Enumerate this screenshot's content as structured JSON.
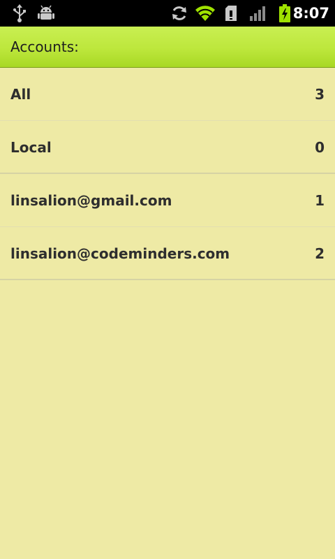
{
  "status_bar": {
    "time": "8:07",
    "icons": [
      "usb-icon",
      "android-debug-icon",
      "sync-icon",
      "wifi-icon",
      "sd-card-icon",
      "signal-icon",
      "battery-charging-icon"
    ],
    "wifi_color": "#9fe200",
    "battery_color": "#9fe200"
  },
  "header": {
    "title": "Accounts:",
    "color": "#c2ea45"
  },
  "accounts": [
    {
      "label": "All",
      "count": "3"
    },
    {
      "label": "Local",
      "count": "0"
    },
    {
      "label": "linsalion@gmail.com",
      "count": "1"
    },
    {
      "label": "linsalion@codeminders.com",
      "count": "2"
    }
  ],
  "background_color": "#eeeaa5"
}
